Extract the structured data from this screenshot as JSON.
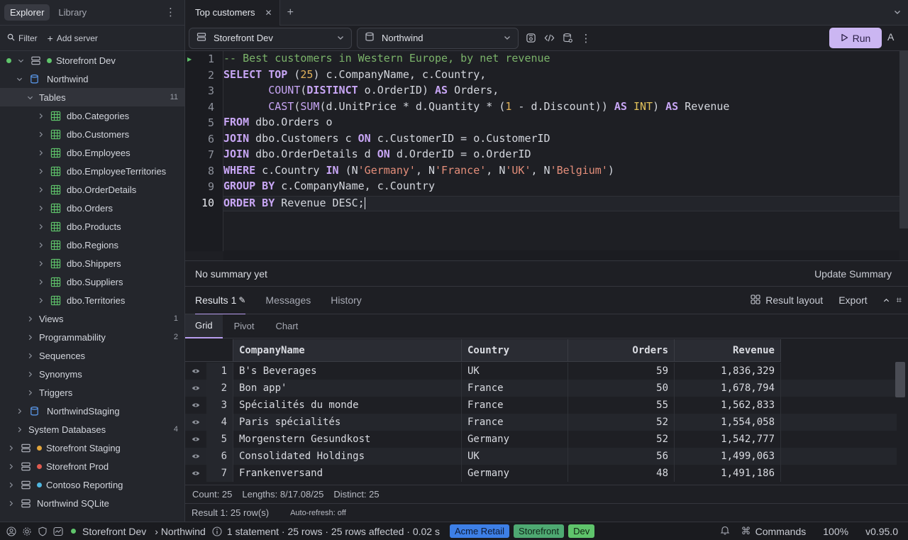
{
  "sidebar": {
    "tabs": [
      "Explorer",
      "Library"
    ],
    "actions": {
      "filter": "Filter",
      "add_server": "Add server"
    },
    "tree": [
      {
        "label": "Storefront Dev",
        "kind": "server",
        "dot": "#5fc46b"
      },
      {
        "label": "Northwind",
        "kind": "database"
      },
      {
        "label": "Tables",
        "kind": "folder",
        "count": "11"
      },
      {
        "label": "dbo.Categories",
        "kind": "table"
      },
      {
        "label": "dbo.Customers",
        "kind": "table"
      },
      {
        "label": "dbo.Employees",
        "kind": "table"
      },
      {
        "label": "dbo.EmployeeTerritories",
        "kind": "table"
      },
      {
        "label": "dbo.OrderDetails",
        "kind": "table"
      },
      {
        "label": "dbo.Orders",
        "kind": "table"
      },
      {
        "label": "dbo.Products",
        "kind": "table"
      },
      {
        "label": "dbo.Regions",
        "kind": "table"
      },
      {
        "label": "dbo.Shippers",
        "kind": "table"
      },
      {
        "label": "dbo.Suppliers",
        "kind": "table"
      },
      {
        "label": "dbo.Territories",
        "kind": "table"
      },
      {
        "label": "Views",
        "kind": "folder",
        "count": "1"
      },
      {
        "label": "Programmability",
        "kind": "folder",
        "count": "2"
      },
      {
        "label": "Sequences",
        "kind": "folder"
      },
      {
        "label": "Synonyms",
        "kind": "folder"
      },
      {
        "label": "Triggers",
        "kind": "folder"
      },
      {
        "label": "NorthwindStaging",
        "kind": "database"
      },
      {
        "label": "System Databases",
        "kind": "folder",
        "count": "4"
      },
      {
        "label": "Storefront Staging",
        "kind": "server",
        "dot": "#e2a53b"
      },
      {
        "label": "Storefront Prod",
        "kind": "server",
        "dot": "#e05a4f"
      },
      {
        "label": "Contoso Reporting",
        "kind": "server",
        "dot": "#4fb6e0"
      },
      {
        "label": "Northwind SQLite",
        "kind": "server"
      }
    ]
  },
  "tabs": {
    "active": "Top customers"
  },
  "toolbar": {
    "connection": "Storefront Dev",
    "database": "Northwind",
    "run_label": "Run",
    "a_label": "A"
  },
  "editor": {
    "lines": [
      "1",
      "2",
      "3",
      "4",
      "5",
      "6",
      "7",
      "8",
      "9",
      "10"
    ],
    "code": [
      [
        [
          "cm",
          "-- Best customers in Western Europe, by net revenue"
        ]
      ],
      [
        [
          "kw",
          "SELECT"
        ],
        [
          "id",
          " "
        ],
        [
          "kw",
          "TOP"
        ],
        [
          "id",
          " ("
        ],
        [
          "nu",
          "25"
        ],
        [
          "id",
          ") c.CompanyName, c.Country,"
        ]
      ],
      [
        [
          "id",
          "       "
        ],
        [
          "fn",
          "COUNT"
        ],
        [
          "id",
          "("
        ],
        [
          "kw",
          "DISTINCT"
        ],
        [
          "id",
          " o.OrderID) "
        ],
        [
          "kw",
          "AS"
        ],
        [
          "id",
          " Orders,"
        ]
      ],
      [
        [
          "id",
          "       "
        ],
        [
          "fn",
          "CAST"
        ],
        [
          "id",
          "("
        ],
        [
          "fn",
          "SUM"
        ],
        [
          "id",
          "(d.UnitPrice * d.Quantity * ("
        ],
        [
          "nu",
          "1"
        ],
        [
          "id",
          " - d.Discount)) "
        ],
        [
          "kw",
          "AS"
        ],
        [
          "id",
          " "
        ],
        [
          "ty",
          "INT"
        ],
        [
          "id",
          ") "
        ],
        [
          "kw",
          "AS"
        ],
        [
          "id",
          " Revenue"
        ]
      ],
      [
        [
          "kw",
          "FROM"
        ],
        [
          "id",
          " dbo.Orders o"
        ]
      ],
      [
        [
          "kw",
          "JOIN"
        ],
        [
          "id",
          " dbo.Customers c "
        ],
        [
          "kw",
          "ON"
        ],
        [
          "id",
          " c.CustomerID = o.CustomerID"
        ]
      ],
      [
        [
          "kw",
          "JOIN"
        ],
        [
          "id",
          " dbo.OrderDetails d "
        ],
        [
          "kw",
          "ON"
        ],
        [
          "id",
          " d.OrderID = o.OrderID"
        ]
      ],
      [
        [
          "kw",
          "WHERE"
        ],
        [
          "id",
          " c.Country "
        ],
        [
          "kw",
          "IN"
        ],
        [
          "id",
          " (N"
        ],
        [
          "st",
          "'Germany'"
        ],
        [
          "id",
          ", N"
        ],
        [
          "st",
          "'France'"
        ],
        [
          "id",
          ", N"
        ],
        [
          "st",
          "'UK'"
        ],
        [
          "id",
          ", N"
        ],
        [
          "st",
          "'Belgium'"
        ],
        [
          "id",
          ")"
        ]
      ],
      [
        [
          "kw",
          "GROUP BY"
        ],
        [
          "id",
          " c.CompanyName, c.Country"
        ]
      ],
      [
        [
          "kw",
          "ORDER BY"
        ],
        [
          "id",
          " Revenue DESC;"
        ]
      ]
    ]
  },
  "summary": {
    "text": "No summary yet",
    "button": "Update Summary"
  },
  "results": {
    "tabs": [
      "Results 1",
      "Messages",
      "History"
    ],
    "result_layout": "Result layout",
    "export": "Export",
    "sub_tabs": [
      "Grid",
      "Pivot",
      "Chart"
    ],
    "columns": [
      "CompanyName",
      "Country",
      "Orders",
      "Revenue"
    ],
    "rows": [
      [
        "1",
        "B's Beverages",
        "UK",
        "59",
        "1,836,329"
      ],
      [
        "2",
        "Bon app'",
        "France",
        "50",
        "1,678,794"
      ],
      [
        "3",
        "Spécialités du monde",
        "France",
        "55",
        "1,562,833"
      ],
      [
        "4",
        "Paris spécialités",
        "France",
        "52",
        "1,554,058"
      ],
      [
        "5",
        "Morgenstern Gesundkost",
        "Germany",
        "52",
        "1,542,777"
      ],
      [
        "6",
        "Consolidated Holdings",
        "UK",
        "56",
        "1,499,063"
      ],
      [
        "7",
        "Frankenversand",
        "Germany",
        "48",
        "1,491,186"
      ]
    ],
    "stats": {
      "count": "Count: 25",
      "lengths": "Lengths: 8/17.08/25",
      "distinct": "Distinct: 25"
    },
    "rows_label": "Result 1: 25 row(s)",
    "auto_refresh": "Auto-refresh: off"
  },
  "statusbar": {
    "connection": "Storefront Dev",
    "database": "› Northwind",
    "info": "1 statement · 25 rows · 25 rows affected · 0.02 s",
    "tags": [
      {
        "label": "Acme Retail",
        "bg": "#3d7fe6",
        "fg": "#0e1a33"
      },
      {
        "label": "Storefront",
        "bg": "#4ea972",
        "fg": "#0f2418"
      },
      {
        "label": "Dev",
        "bg": "#5fc46b",
        "fg": "#102412"
      }
    ],
    "commands": "Commands",
    "zoom": "100%",
    "version": "v0.95.0"
  },
  "colors": {
    "accent": "#cbb6f2",
    "table_icon": "#5fc46b",
    "db_icon": "#5b9bf0"
  }
}
